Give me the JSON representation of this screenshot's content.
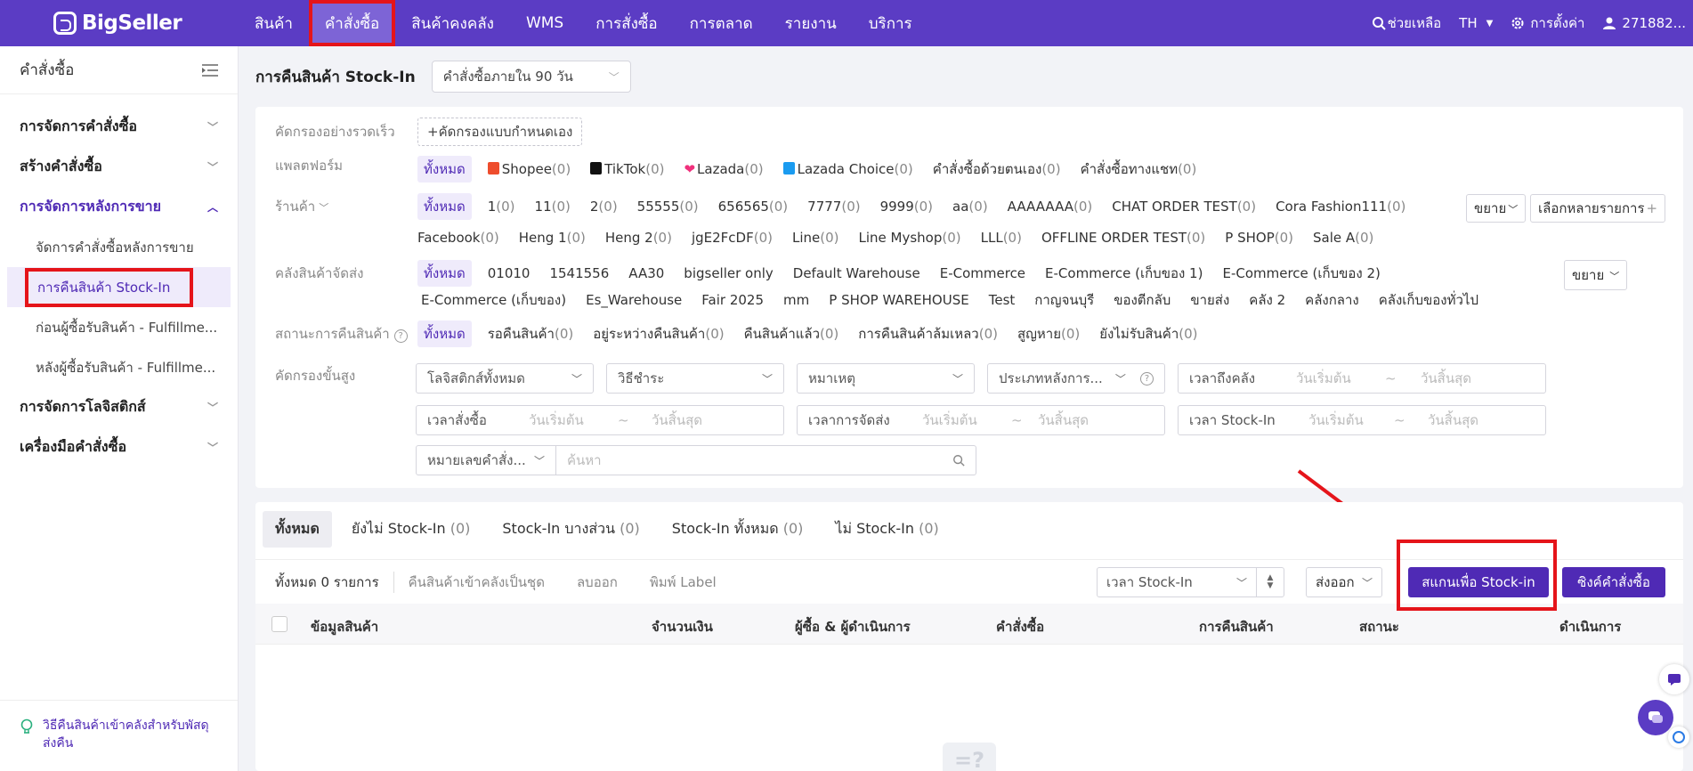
{
  "brand": {
    "name": "BigSeller"
  },
  "nav": {
    "items": [
      {
        "label": "สินค้า"
      },
      {
        "label": "คำสั่งซื้อ"
      },
      {
        "label": "สินค้าคงคลัง"
      },
      {
        "label": "WMS"
      },
      {
        "label": "การสั่งซื้อ"
      },
      {
        "label": "การตลาด"
      },
      {
        "label": "รายงาน"
      },
      {
        "label": "บริการ"
      }
    ],
    "help": "ช่วยเหลือ",
    "language": "TH",
    "settings": "การตั้งค่า",
    "user": "271882..."
  },
  "sidebar": {
    "title": "คำสั่งซื้อ",
    "groups": [
      {
        "label": "การจัดการคำสั่งซื้อ"
      },
      {
        "label": "สร้างคำสั่งซื้อ"
      },
      {
        "label": "การจัดการหลังการขาย"
      },
      {
        "label": "การจัดการโลจิสติกส์"
      },
      {
        "label": "เครื่องมือคำสั่งซื้อ"
      }
    ],
    "sub_items": [
      {
        "label": "จัดการคำสั่งซื้อหลังการขาย"
      },
      {
        "label": "การคืนสินค้า Stock-In"
      },
      {
        "label": "ก่อนผู้ซื้อรับสินค้า - Fulfillme..."
      },
      {
        "label": "หลังผู้ซื้อรับสินค้า - Fulfillme..."
      }
    ],
    "footer": "วิธีคืนสินค้าเข้าคลังสำหรับพัสดุส่งคืน"
  },
  "main": {
    "title": "การคืนสินค้า Stock-In",
    "period_select": "คำสั่งซื้อภายใน 90 วัน"
  },
  "filters": {
    "quick": {
      "label": "คัดกรองอย่างรวดเร็ว",
      "add_button": "+คัดกรองแบบกำหนดเอง"
    },
    "platform": {
      "label": "แพลตฟอร์ม",
      "items": [
        {
          "name": "ทั้งหมด",
          "count": ""
        },
        {
          "name": "Shopee",
          "count": "(0)"
        },
        {
          "name": "TikTok",
          "count": "(0)"
        },
        {
          "name": "Lazada",
          "count": "(0)"
        },
        {
          "name": "Lazada Choice",
          "count": "(0)"
        },
        {
          "name": "คำสั่งซื้อด้วยตนเอง",
          "count": "(0)"
        },
        {
          "name": "คำสั่งซื้อทางแชท",
          "count": "(0)"
        }
      ]
    },
    "store": {
      "label": "ร้านค้า",
      "row1": [
        {
          "name": "ทั้งหมด",
          "count": ""
        },
        {
          "name": "1",
          "count": "(0)"
        },
        {
          "name": "11",
          "count": "(0)"
        },
        {
          "name": "2",
          "count": "(0)"
        },
        {
          "name": "55555",
          "count": "(0)"
        },
        {
          "name": "656565",
          "count": "(0)"
        },
        {
          "name": "7777",
          "count": "(0)"
        },
        {
          "name": "9999",
          "count": "(0)"
        },
        {
          "name": "aa",
          "count": "(0)"
        },
        {
          "name": "AAAAAAA",
          "count": "(0)"
        },
        {
          "name": "CHAT ORDER TEST",
          "count": "(0)"
        },
        {
          "name": "Cora Fashion111",
          "count": "(0)"
        }
      ],
      "row2": [
        {
          "name": "Facebook",
          "count": "(0)"
        },
        {
          "name": "Heng 1",
          "count": "(0)"
        },
        {
          "name": "Heng 2",
          "count": "(0)"
        },
        {
          "name": "jgE2FcDF",
          "count": "(0)"
        },
        {
          "name": "Line",
          "count": "(0)"
        },
        {
          "name": "Line Myshop",
          "count": "(0)"
        },
        {
          "name": "LLL",
          "count": "(0)"
        },
        {
          "name": "OFFLINE ORDER TEST",
          "count": "(0)"
        },
        {
          "name": "P SHOP",
          "count": "(0)"
        },
        {
          "name": "Sale A",
          "count": "(0)"
        }
      ],
      "expand": "ขยาย",
      "multi_select": "เลือกหลายรายการ"
    },
    "warehouse": {
      "label": "คลังสินค้าจัดส่ง",
      "row1": [
        "ทั้งหมด",
        "01010",
        "1541556",
        "AA30",
        "bigseller only",
        "Default Warehouse",
        "E-Commerce",
        "E-Commerce (เก็บของ 1)",
        "E-Commerce (เก็บของ 2)"
      ],
      "row2": [
        "E-Commerce (เก็บของ)",
        "Es_Warehouse",
        "Fair 2025",
        "mm",
        "P SHOP WAREHOUSE",
        "Test",
        "กาญจนบุรี",
        "ของตีกลับ",
        "ขายส่ง",
        "คลัง 2",
        "คลังกลาง",
        "คลังเก็บของทั่วไป"
      ],
      "expand": "ขยาย"
    },
    "status": {
      "label": "สถานะการคืนสินค้า",
      "items": [
        {
          "name": "ทั้งหมด",
          "count": ""
        },
        {
          "name": "รอคืนสินค้า",
          "count": "(0)"
        },
        {
          "name": "อยู่ระหว่างคืนสินค้า",
          "count": "(0)"
        },
        {
          "name": "คืนสินค้าแล้ว",
          "count": "(0)"
        },
        {
          "name": "การคืนสินค้าล้มเหลว",
          "count": "(0)"
        },
        {
          "name": "สูญหาย",
          "count": "(0)"
        },
        {
          "name": "ยังไม่รับสินค้า",
          "count": "(0)"
        }
      ]
    },
    "advanced": {
      "label": "คัดกรองขั้นสูง",
      "logistics": "โลจิสติกส์ทั้งหมด",
      "payment": "วิธีชำระ",
      "reason": "หมาเหตุ",
      "after_type": "ประเภทหลังการ...",
      "arrival_time": "เวลาถึงคลัง",
      "order_time": "เวลาสั่งซื้อ",
      "ship_time": "เวลาการจัดส่ง",
      "stockin_time": "เวลา Stock-In",
      "start_ph": "วันเริ่มต้น",
      "end_ph": "วันสิ้นสุด",
      "tilde": "~",
      "search_type": "หมายเลขคำสั่ง...",
      "search_ph": "ค้นหา"
    }
  },
  "tabs": [
    {
      "label": "ทั้งหมด",
      "count": ""
    },
    {
      "label": "ยังไม่ Stock-In",
      "count": "(0)"
    },
    {
      "label": "Stock-In บางส่วน",
      "count": "(0)"
    },
    {
      "label": "Stock-In ทั้งหมด",
      "count": "(0)"
    },
    {
      "label": "ไม่ Stock-In",
      "count": "(0)"
    }
  ],
  "toolbar": {
    "total": "ทั้งหมด 0 รายการ",
    "bundle_return": "คืนสินค้าเข้าคลังเป็นชุด",
    "delete": "ลบออก",
    "print": "พิมพ์ Label",
    "sort_field": "เวลา Stock-In",
    "export": "ส่งออก",
    "scan_button": "สแกนเพื่อ Stock-in",
    "sync_button": "ซิงค์คำสั่งซื้อ"
  },
  "table": {
    "headers": [
      "ข้อมูลสินค้า",
      "จำนวนเงิน",
      "ผู้ซื้อ & ผู้ดำเนินการ",
      "คำสั่งซื้อ",
      "การคืนสินค้า",
      "สถานะ",
      "ดำเนินการ"
    ]
  },
  "colors": {
    "brand": "#5b3cc4",
    "accent": "#4f2ab5",
    "highlight_box": "#e5141a"
  }
}
